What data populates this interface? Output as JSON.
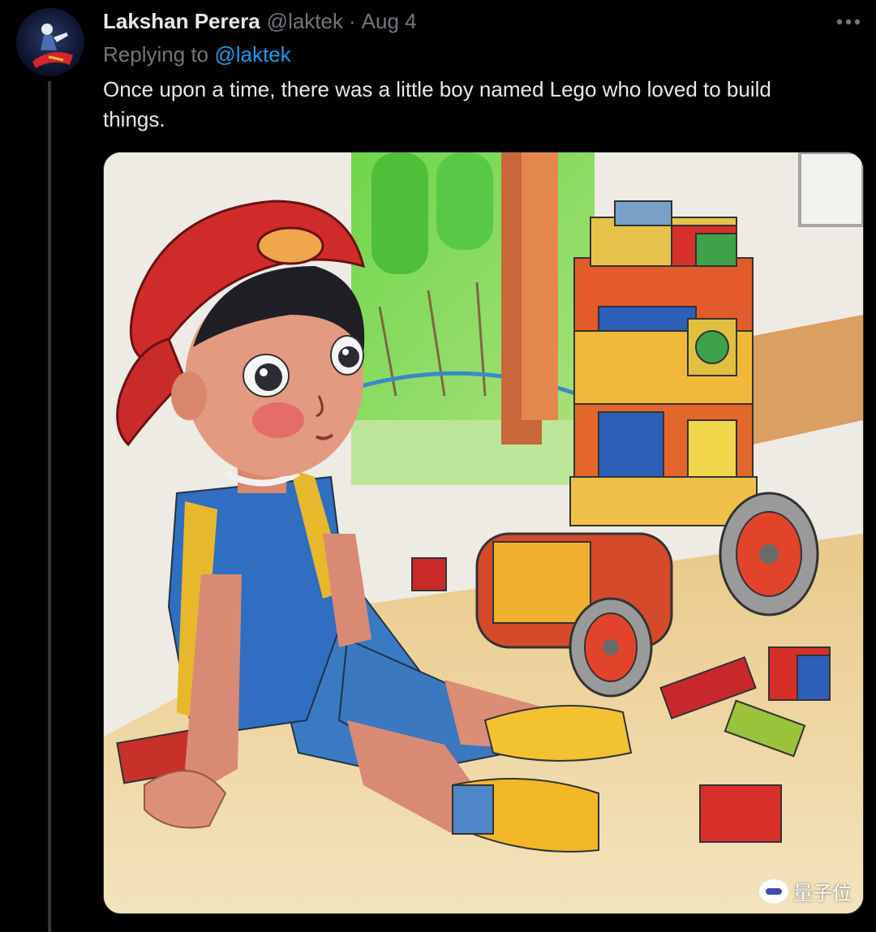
{
  "tweet": {
    "display_name": "Lakshan Perera",
    "handle": "@laktek",
    "separator": "·",
    "date": "Aug 4",
    "more_icon": "more-horizontal-icon",
    "replying_prefix": "Replying to",
    "replying_handle": "@laktek",
    "text": "Once upon a time, there was a little boy named Lego who loved to build things."
  },
  "media": {
    "watermark_text": "量子位"
  },
  "colors": {
    "background": "#000000",
    "text": "#e7e9ea",
    "muted": "#71767b",
    "link": "#1d9bf0",
    "thread_line": "#333639"
  }
}
